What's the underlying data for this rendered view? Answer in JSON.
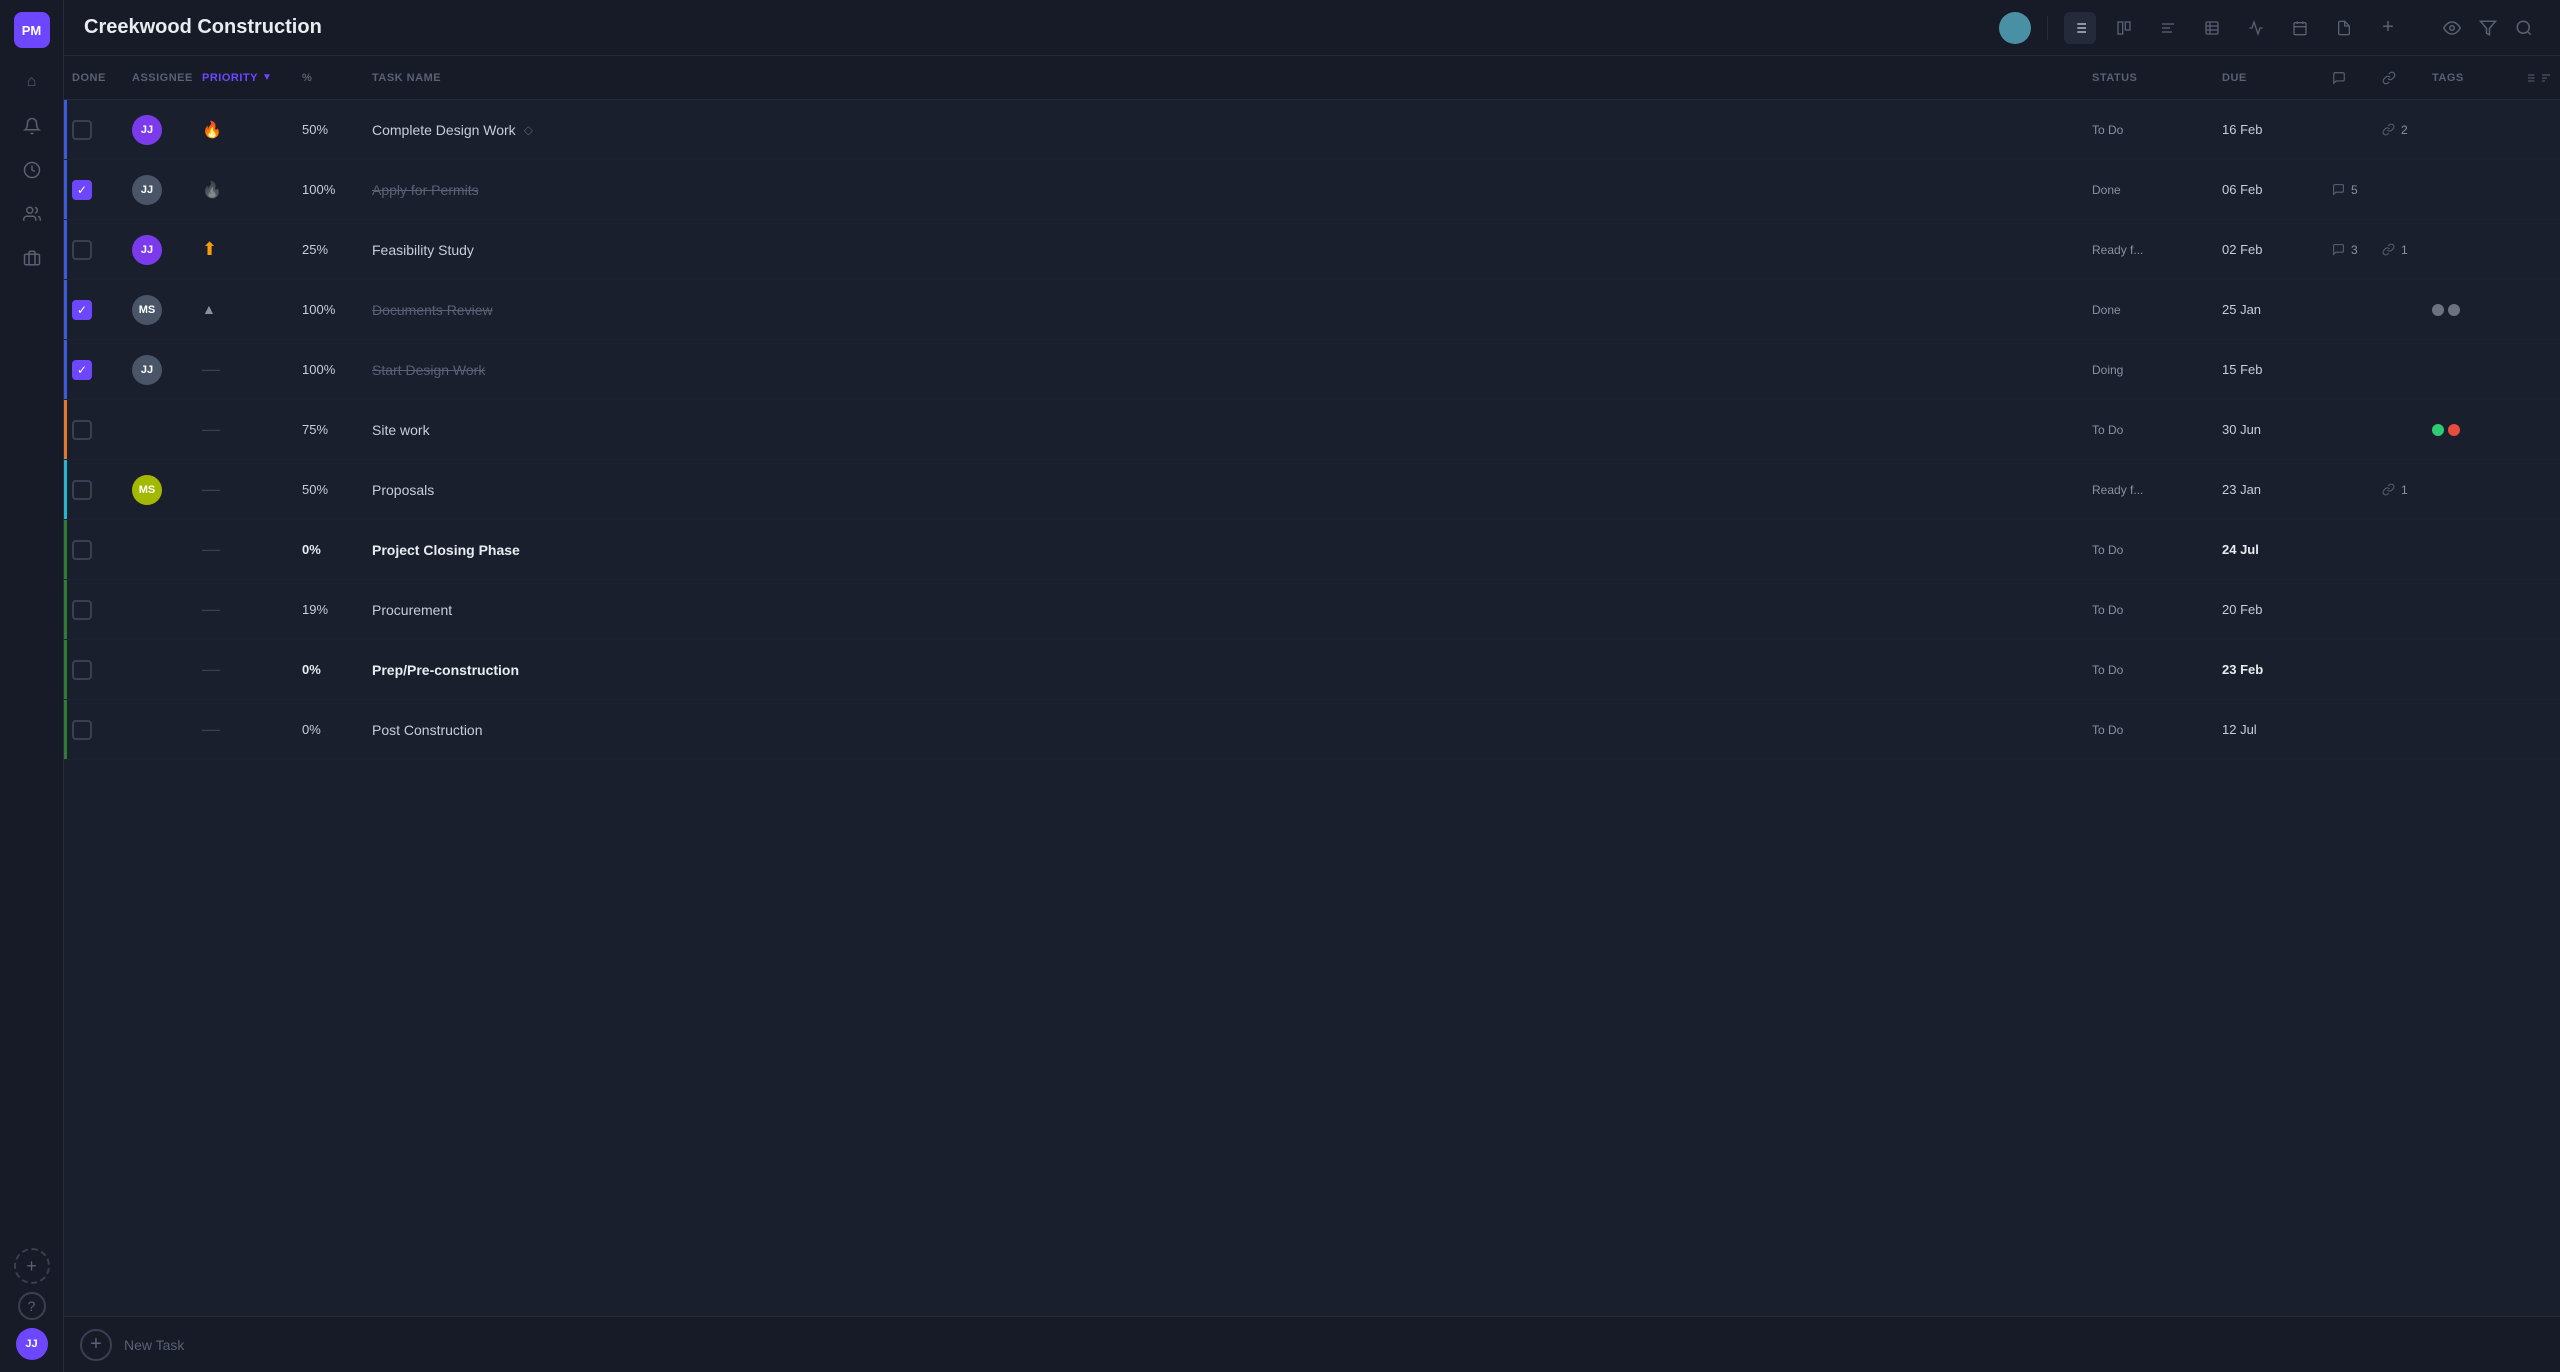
{
  "app": {
    "title": "Creekwood Construction"
  },
  "sidebar": {
    "logo": "PM",
    "items": [
      {
        "name": "home-icon",
        "icon": "⌂",
        "label": "Home"
      },
      {
        "name": "notifications-icon",
        "icon": "🔔",
        "label": "Notifications"
      },
      {
        "name": "history-icon",
        "icon": "◷",
        "label": "History"
      },
      {
        "name": "team-icon",
        "icon": "👥",
        "label": "Team"
      },
      {
        "name": "portfolio-icon",
        "icon": "💼",
        "label": "Portfolio"
      }
    ],
    "bottom": [
      {
        "name": "add-project-icon",
        "icon": "+",
        "label": "Add"
      },
      {
        "name": "help-icon",
        "icon": "?",
        "label": "Help"
      }
    ],
    "avatar": "JJ"
  },
  "topbar": {
    "title": "Creekwood Construction",
    "icons": [
      {
        "name": "list-view-icon",
        "icon": "≡",
        "active": true
      },
      {
        "name": "board-view-icon",
        "icon": "⊞",
        "active": false
      },
      {
        "name": "gantt-view-icon",
        "icon": "≡",
        "active": false
      },
      {
        "name": "table-view-icon",
        "icon": "⊟",
        "active": false
      },
      {
        "name": "timeline-view-icon",
        "icon": "∿",
        "active": false
      },
      {
        "name": "calendar-view-icon",
        "icon": "⊡",
        "active": false
      },
      {
        "name": "files-view-icon",
        "icon": "□",
        "active": false
      },
      {
        "name": "add-view-icon",
        "icon": "+",
        "active": false
      }
    ],
    "rightIcons": [
      {
        "name": "watch-icon",
        "icon": "◎"
      },
      {
        "name": "filter-icon",
        "icon": "⊿"
      },
      {
        "name": "search-icon",
        "icon": "⌕"
      }
    ]
  },
  "table": {
    "columns": [
      {
        "key": "done",
        "label": "DONE"
      },
      {
        "key": "assignee",
        "label": "ASSIGNEE"
      },
      {
        "key": "priority",
        "label": "PRIORITY",
        "sortable": true
      },
      {
        "key": "percent",
        "label": "%"
      },
      {
        "key": "taskName",
        "label": "TASK NAME"
      },
      {
        "key": "status",
        "label": "STATUS"
      },
      {
        "key": "due",
        "label": "DUE"
      },
      {
        "key": "comments",
        "label": ""
      },
      {
        "key": "links",
        "label": ""
      },
      {
        "key": "tags",
        "label": "TAGS"
      }
    ],
    "rows": [
      {
        "id": 1,
        "done": false,
        "assignee": "JJ",
        "assigneeColor": "purple",
        "priority": "🔥",
        "priorityType": "fire",
        "percent": "50%",
        "percentBold": false,
        "taskName": "Complete Design Work",
        "taskNameSuffix": "◇",
        "strikethrough": false,
        "bold": false,
        "status": "To Do",
        "due": "16 Feb",
        "dueBold": false,
        "comments": "",
        "commentCount": "",
        "links": "🔗",
        "linkCount": "2",
        "tags": [],
        "indicator": "blue"
      },
      {
        "id": 2,
        "done": true,
        "assignee": "JJ",
        "assigneeColor": "gray",
        "priority": "🔥",
        "priorityType": "fire-gray",
        "percent": "100%",
        "percentBold": false,
        "taskName": "Apply for Permits",
        "taskNameSuffix": "",
        "strikethrough": true,
        "bold": false,
        "status": "Done",
        "due": "06 Feb",
        "dueBold": false,
        "comments": "💬",
        "commentCount": "5",
        "links": "",
        "linkCount": "",
        "tags": [],
        "indicator": "blue"
      },
      {
        "id": 3,
        "done": false,
        "assignee": "JJ",
        "assigneeColor": "purple",
        "priority": "⬆",
        "priorityType": "up",
        "percent": "25%",
        "percentBold": false,
        "taskName": "Feasibility Study",
        "taskNameSuffix": "",
        "strikethrough": false,
        "bold": false,
        "status": "Ready f...",
        "due": "02 Feb",
        "dueBold": false,
        "comments": "💬",
        "commentCount": "3",
        "links": "🔗",
        "linkCount": "1",
        "tags": [],
        "indicator": "blue"
      },
      {
        "id": 4,
        "done": true,
        "assignee": "MS",
        "assigneeColor": "gray",
        "priority": "▲",
        "priorityType": "up-small",
        "percent": "100%",
        "percentBold": false,
        "taskName": "Documents Review",
        "taskNameSuffix": "",
        "strikethrough": true,
        "bold": false,
        "status": "Done",
        "due": "25 Jan",
        "dueBold": false,
        "comments": "",
        "commentCount": "",
        "links": "",
        "linkCount": "",
        "tags": [
          "gray",
          "gray"
        ],
        "indicator": "blue"
      },
      {
        "id": 5,
        "done": true,
        "assignee": "JJ",
        "assigneeColor": "gray",
        "priority": "—",
        "priorityType": "dash",
        "percent": "100%",
        "percentBold": false,
        "taskName": "Start Design Work",
        "taskNameSuffix": "",
        "strikethrough": true,
        "bold": false,
        "status": "Doing",
        "due": "15 Feb",
        "dueBold": false,
        "comments": "",
        "commentCount": "",
        "links": "",
        "linkCount": "",
        "tags": [],
        "indicator": "blue"
      },
      {
        "id": 6,
        "done": false,
        "assignee": "",
        "assigneeColor": "",
        "priority": "—",
        "priorityType": "dash",
        "percent": "75%",
        "percentBold": false,
        "taskName": "Site work",
        "taskNameSuffix": "",
        "strikethrough": false,
        "bold": false,
        "status": "To Do",
        "due": "30 Jun",
        "dueBold": false,
        "comments": "",
        "commentCount": "",
        "links": "",
        "linkCount": "",
        "tags": [
          "green",
          "red"
        ],
        "indicator": "orange"
      },
      {
        "id": 7,
        "done": false,
        "assignee": "MS",
        "assigneeColor": "green-yellow",
        "priority": "—",
        "priorityType": "dash",
        "percent": "50%",
        "percentBold": false,
        "taskName": "Proposals",
        "taskNameSuffix": "",
        "strikethrough": false,
        "bold": false,
        "status": "Ready f...",
        "due": "23 Jan",
        "dueBold": false,
        "comments": "",
        "commentCount": "",
        "links": "🔗",
        "linkCount": "1",
        "tags": [],
        "indicator": "cyan"
      },
      {
        "id": 8,
        "done": false,
        "assignee": "",
        "assigneeColor": "",
        "priority": "—",
        "priorityType": "dash",
        "percent": "0%",
        "percentBold": true,
        "taskName": "Project Closing Phase",
        "taskNameSuffix": "",
        "strikethrough": false,
        "bold": true,
        "status": "To Do",
        "due": "24 Jul",
        "dueBold": true,
        "comments": "",
        "commentCount": "",
        "links": "",
        "linkCount": "",
        "tags": [],
        "indicator": "green"
      },
      {
        "id": 9,
        "done": false,
        "assignee": "",
        "assigneeColor": "",
        "priority": "—",
        "priorityType": "dash",
        "percent": "19%",
        "percentBold": false,
        "taskName": "Procurement",
        "taskNameSuffix": "",
        "strikethrough": false,
        "bold": false,
        "status": "To Do",
        "due": "20 Feb",
        "dueBold": false,
        "comments": "",
        "commentCount": "",
        "links": "",
        "linkCount": "",
        "tags": [],
        "indicator": "green"
      },
      {
        "id": 10,
        "done": false,
        "assignee": "",
        "assigneeColor": "",
        "priority": "—",
        "priorityType": "dash",
        "percent": "0%",
        "percentBold": true,
        "taskName": "Prep/Pre-construction",
        "taskNameSuffix": "",
        "strikethrough": false,
        "bold": true,
        "status": "To Do",
        "due": "23 Feb",
        "dueBold": true,
        "comments": "",
        "commentCount": "",
        "links": "",
        "linkCount": "",
        "tags": [],
        "indicator": "green"
      },
      {
        "id": 11,
        "done": false,
        "assignee": "",
        "assigneeColor": "",
        "priority": "—",
        "priorityType": "dash",
        "percent": "0%",
        "percentBold": false,
        "taskName": "Post Construction",
        "taskNameSuffix": "",
        "strikethrough": false,
        "bold": false,
        "status": "To Do",
        "due": "12 Jul",
        "dueBold": false,
        "comments": "",
        "commentCount": "",
        "links": "",
        "linkCount": "",
        "tags": [],
        "indicator": "green"
      }
    ]
  },
  "bottombar": {
    "addLabel": "New Task"
  }
}
